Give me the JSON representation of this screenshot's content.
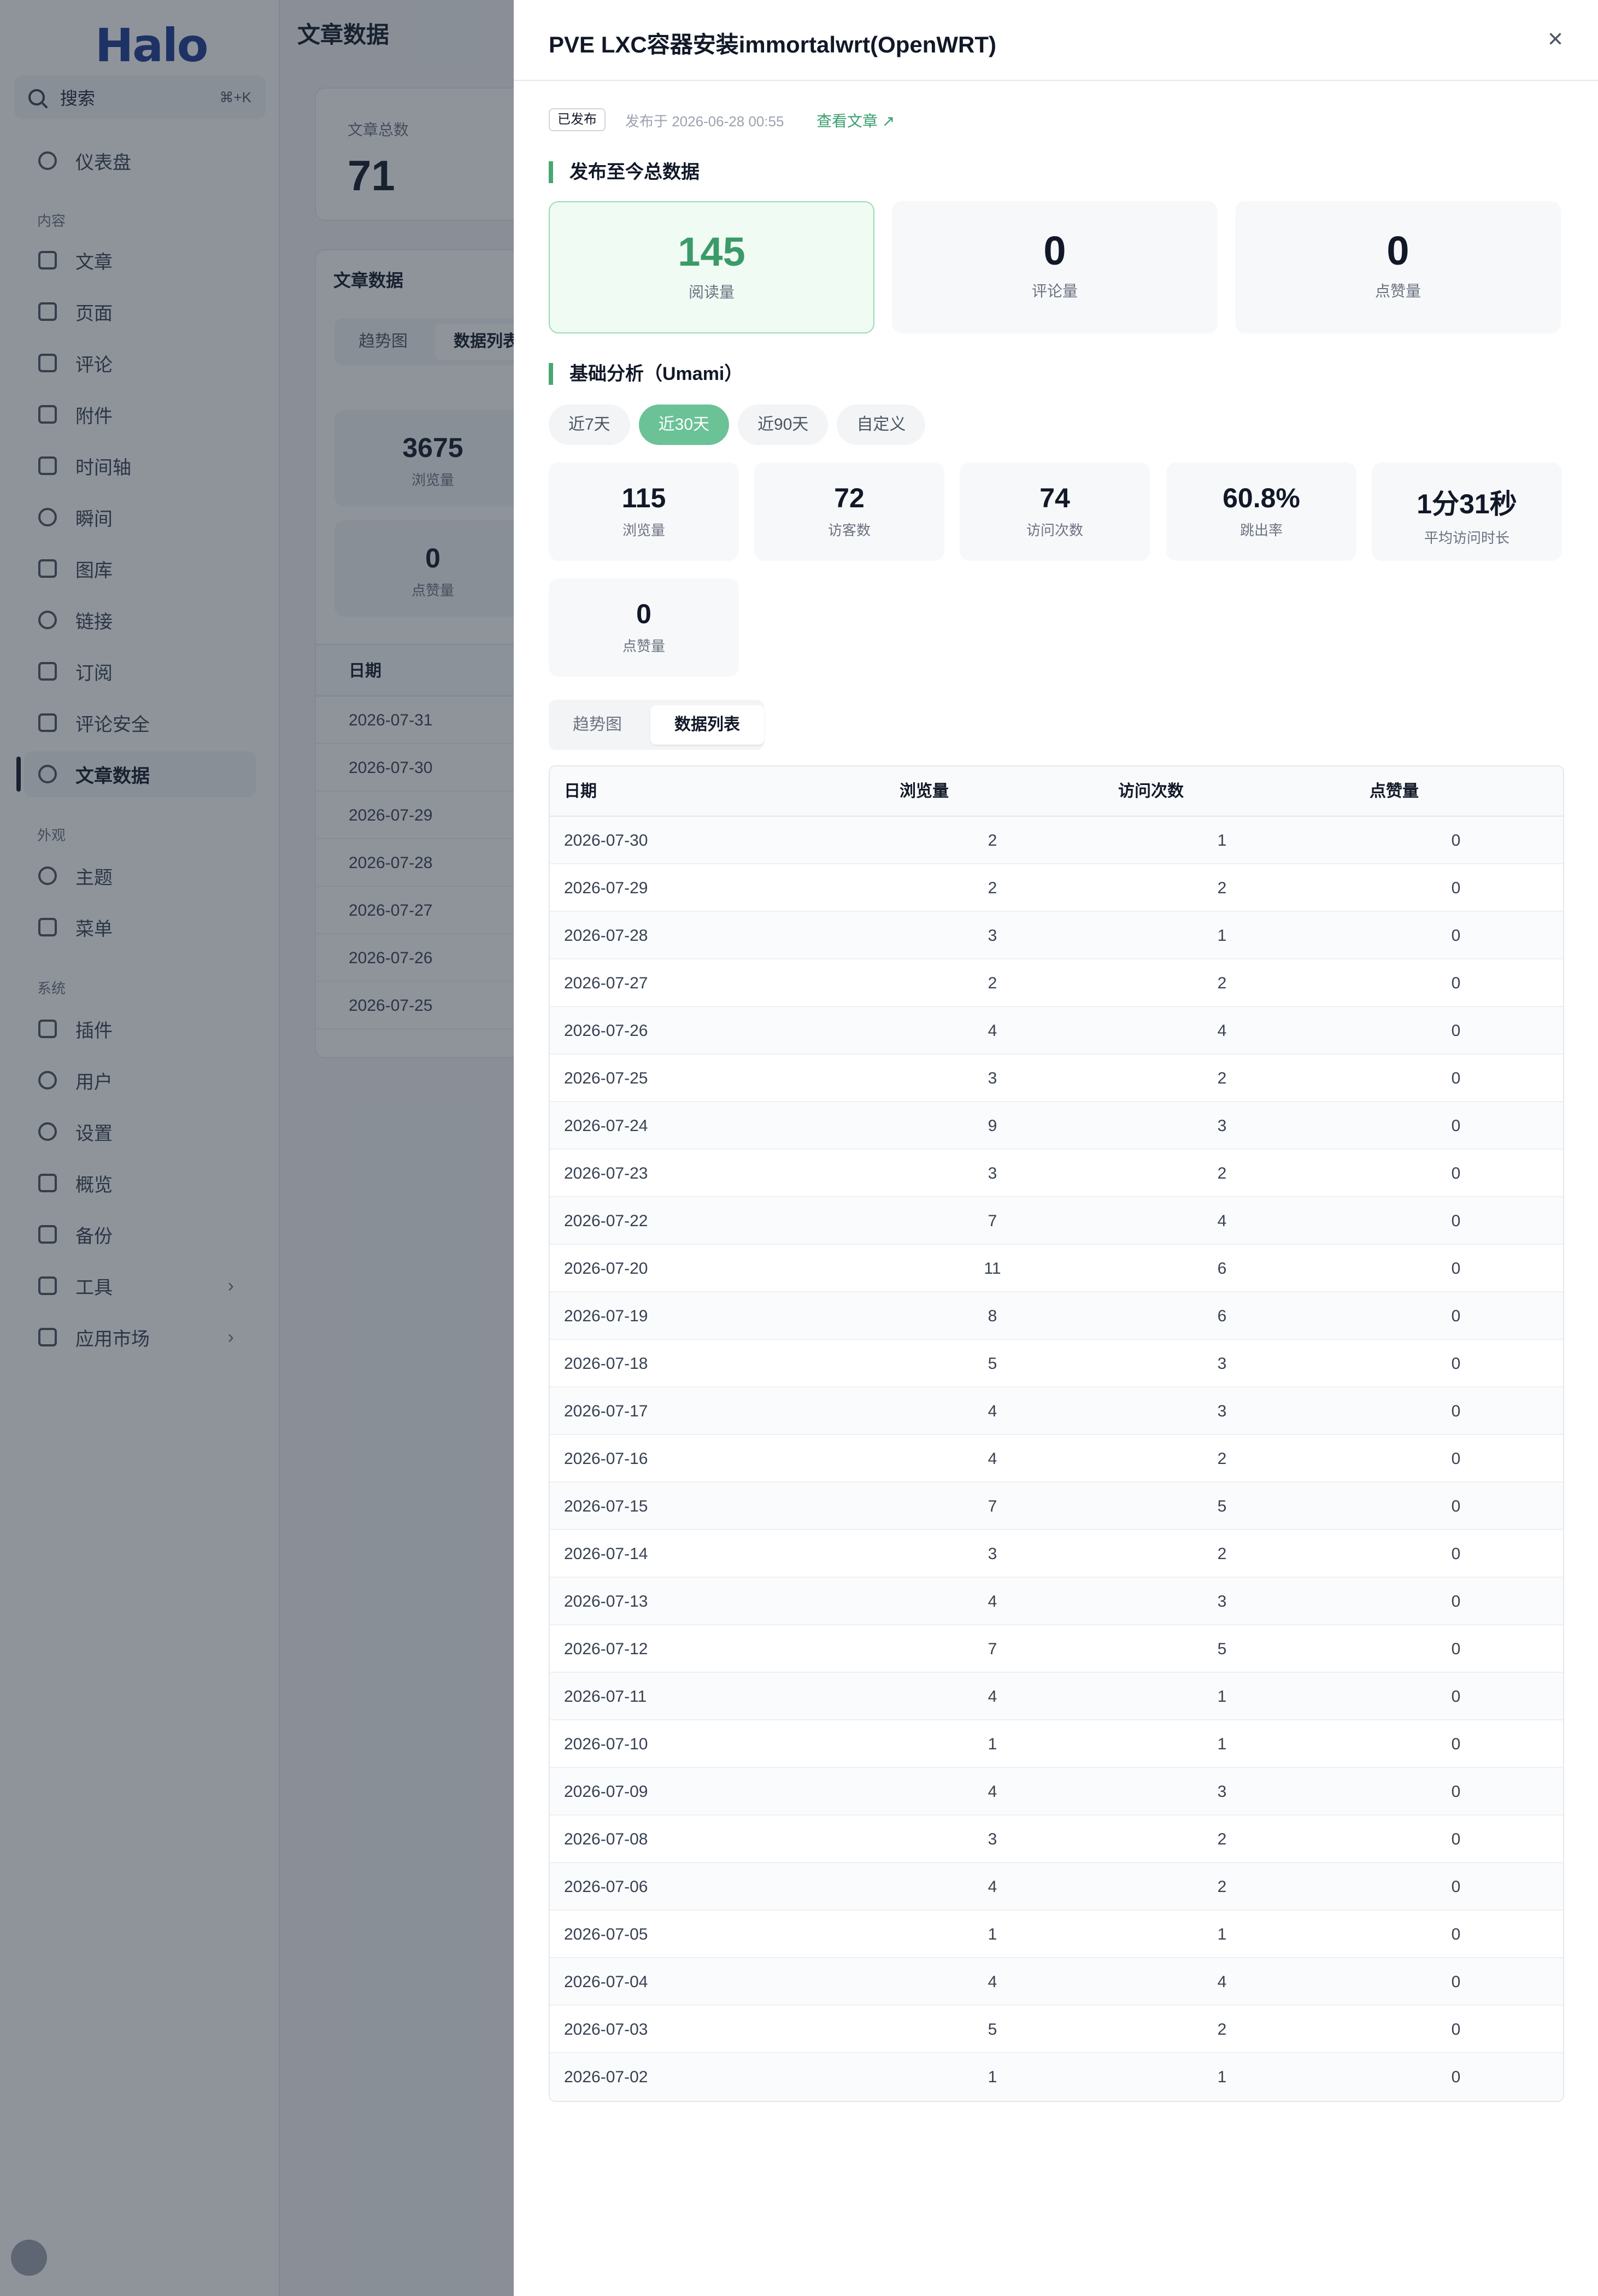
{
  "sidebar": {
    "logo": "Halo",
    "search": {
      "label": "搜索",
      "shortcut": "⌘+K"
    },
    "dashboard": "仪表盘",
    "groups": {
      "content": "内容",
      "appearance": "外观",
      "system": "系统"
    },
    "content_items": [
      "文章",
      "页面",
      "评论",
      "附件",
      "时间轴",
      "瞬间",
      "图库",
      "链接",
      "订阅",
      "评论安全",
      "文章数据"
    ],
    "appearance_items": [
      "主题",
      "菜单"
    ],
    "system_items": [
      "插件",
      "用户",
      "设置",
      "概览",
      "备份",
      "工具",
      "应用市场"
    ]
  },
  "main": {
    "title": "文章数据",
    "total_card": {
      "label": "文章总数",
      "value": "71"
    },
    "data_card": {
      "title": "文章数据",
      "tabs": [
        "趋势图",
        "数据列表"
      ],
      "stats": [
        {
          "value": "3675",
          "label": "浏览量"
        },
        {
          "value": "0",
          "label": "点赞量"
        }
      ],
      "table_header": "日期",
      "dates": [
        "2026-07-31",
        "2026-07-30",
        "2026-07-29",
        "2026-07-28",
        "2026-07-27",
        "2026-07-26",
        "2026-07-25"
      ]
    }
  },
  "drawer": {
    "title": "PVE LXC容器安装immortalwrt(OpenWRT)",
    "close": "×",
    "status_badge": "已发布",
    "published_at": "发布于 2026-06-28 00:55",
    "view_link": "查看文章",
    "total_section": "发布至今总数据",
    "totals": [
      {
        "value": "145",
        "label": "阅读量"
      },
      {
        "value": "0",
        "label": "评论量"
      },
      {
        "value": "0",
        "label": "点赞量"
      }
    ],
    "analysis_section": "基础分析（Umami）",
    "ranges": [
      "近7天",
      "近30天",
      "近90天",
      "自定义"
    ],
    "active_range": "近30天",
    "stats": [
      {
        "value": "115",
        "label": "浏览量"
      },
      {
        "value": "72",
        "label": "访客数"
      },
      {
        "value": "74",
        "label": "访问次数"
      },
      {
        "value": "60.8%",
        "label": "跳出率"
      },
      {
        "value": "1分31秒",
        "label": "平均访问时长"
      },
      {
        "value": "0",
        "label": "点赞量"
      }
    ],
    "tabs": [
      "趋势图",
      "数据列表"
    ],
    "table": {
      "headers": [
        "日期",
        "浏览量",
        "访问次数",
        "点赞量"
      ],
      "rows": [
        [
          "2026-07-30",
          "2",
          "1",
          "0"
        ],
        [
          "2026-07-29",
          "2",
          "2",
          "0"
        ],
        [
          "2026-07-28",
          "3",
          "1",
          "0"
        ],
        [
          "2026-07-27",
          "2",
          "2",
          "0"
        ],
        [
          "2026-07-26",
          "4",
          "4",
          "0"
        ],
        [
          "2026-07-25",
          "3",
          "2",
          "0"
        ],
        [
          "2026-07-24",
          "9",
          "3",
          "0"
        ],
        [
          "2026-07-23",
          "3",
          "2",
          "0"
        ],
        [
          "2026-07-22",
          "7",
          "4",
          "0"
        ],
        [
          "2026-07-20",
          "11",
          "6",
          "0"
        ],
        [
          "2026-07-19",
          "8",
          "6",
          "0"
        ],
        [
          "2026-07-18",
          "5",
          "3",
          "0"
        ],
        [
          "2026-07-17",
          "4",
          "3",
          "0"
        ],
        [
          "2026-07-16",
          "4",
          "2",
          "0"
        ],
        [
          "2026-07-15",
          "7",
          "5",
          "0"
        ],
        [
          "2026-07-14",
          "3",
          "2",
          "0"
        ],
        [
          "2026-07-13",
          "4",
          "3",
          "0"
        ],
        [
          "2026-07-12",
          "7",
          "5",
          "0"
        ],
        [
          "2026-07-11",
          "4",
          "1",
          "0"
        ],
        [
          "2026-07-10",
          "1",
          "1",
          "0"
        ],
        [
          "2026-07-09",
          "4",
          "3",
          "0"
        ],
        [
          "2026-07-08",
          "3",
          "2",
          "0"
        ],
        [
          "2026-07-06",
          "4",
          "2",
          "0"
        ],
        [
          "2026-07-05",
          "1",
          "1",
          "0"
        ],
        [
          "2026-07-04",
          "4",
          "4",
          "0"
        ],
        [
          "2026-07-03",
          "5",
          "2",
          "0"
        ],
        [
          "2026-07-02",
          "1",
          "1",
          "0"
        ]
      ]
    }
  }
}
